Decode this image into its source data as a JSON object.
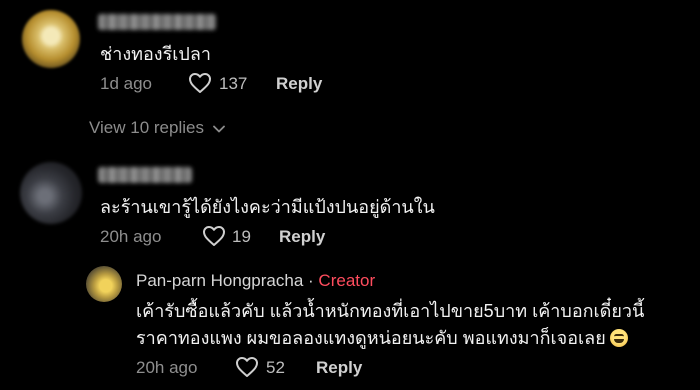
{
  "comments": [
    {
      "text": "ช่างทองรีเปลา",
      "time": "1d ago",
      "likes": "137",
      "reply_label": "Reply",
      "view_replies_label": "View 10 replies"
    },
    {
      "text": "ละร้านเขารู้ได้ยังไงคะว่ามีแป้งปนอยู่ด้านใน",
      "time": "20h ago",
      "likes": "19",
      "reply_label": "Reply"
    }
  ],
  "reply": {
    "author": "Pan-parn Hongpracha",
    "separator": "·",
    "badge": "Creator",
    "text_line1": "เค้ารับซื้อแล้วคับ แล้วน้ำหนักทองที่เอาไปขาย5บาท เค้าบอกเดี๋ยวนี้",
    "text_line2": "ราคาทองแพง ผมขอลองแทงดูหน่อยนะคับ พอแทงมาก็เจอเลย",
    "time": "20h ago",
    "likes": "52",
    "reply_label": "Reply"
  },
  "colors": {
    "background": "#000000",
    "creator_badge": "#ff4d5e"
  }
}
